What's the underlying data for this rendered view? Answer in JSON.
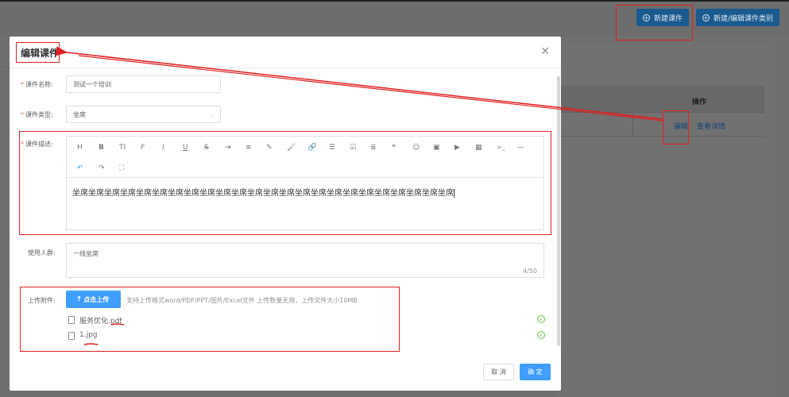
{
  "background": {
    "new_course_button": "新建课件",
    "new_edit_category_button": "新建/编辑课件类别",
    "table_operation_header": "操作",
    "edit_link": "编辑",
    "view_detail_link": "查看详情"
  },
  "modal": {
    "title": "编辑课件",
    "close_icon": "close-icon",
    "form": {
      "name_label": "课件名称:",
      "name_value": "测试一个培训",
      "type_label": "课件类型:",
      "type_value": "坐席",
      "desc_label": "课件描述:",
      "desc_value": "坐席坐席坐席坐席坐席坐席坐席坐席坐席坐席坐席坐席坐席坐席坐席坐席坐席坐席坐席坐席坐席坐席坐席坐席",
      "audience_label": "使用人群:",
      "audience_value": "一线坐席",
      "audience_count": "4/50",
      "attachment_label": "上传附件:",
      "upload_button": "点击上传",
      "upload_tip": "支持上传格式word/PDF/PPT/图片/Excel文件 上传数量无限，上传文件大小10MB",
      "files": [
        "服务优化.pdf",
        "1.jpg"
      ]
    },
    "toolbar": {
      "heading": "H",
      "bold": "B",
      "font_size": "TI",
      "font_family": "F",
      "italic": "I",
      "underline": "U",
      "strikethrough": "S",
      "indent": "⇥",
      "line_height": "≡",
      "color": "✎",
      "bg_color": "🖌",
      "link": "🔗",
      "list": "☰",
      "todo": "☑",
      "justify": "≣",
      "quote": "❝",
      "emoji": "☺",
      "image": "▣",
      "video": "▶",
      "table": "▦",
      "code": ">_",
      "divider": "—",
      "undo": "↶",
      "redo": "↷",
      "fullscreen": "⛶"
    },
    "cancel_button": "取 消",
    "ok_button": "确 定"
  }
}
